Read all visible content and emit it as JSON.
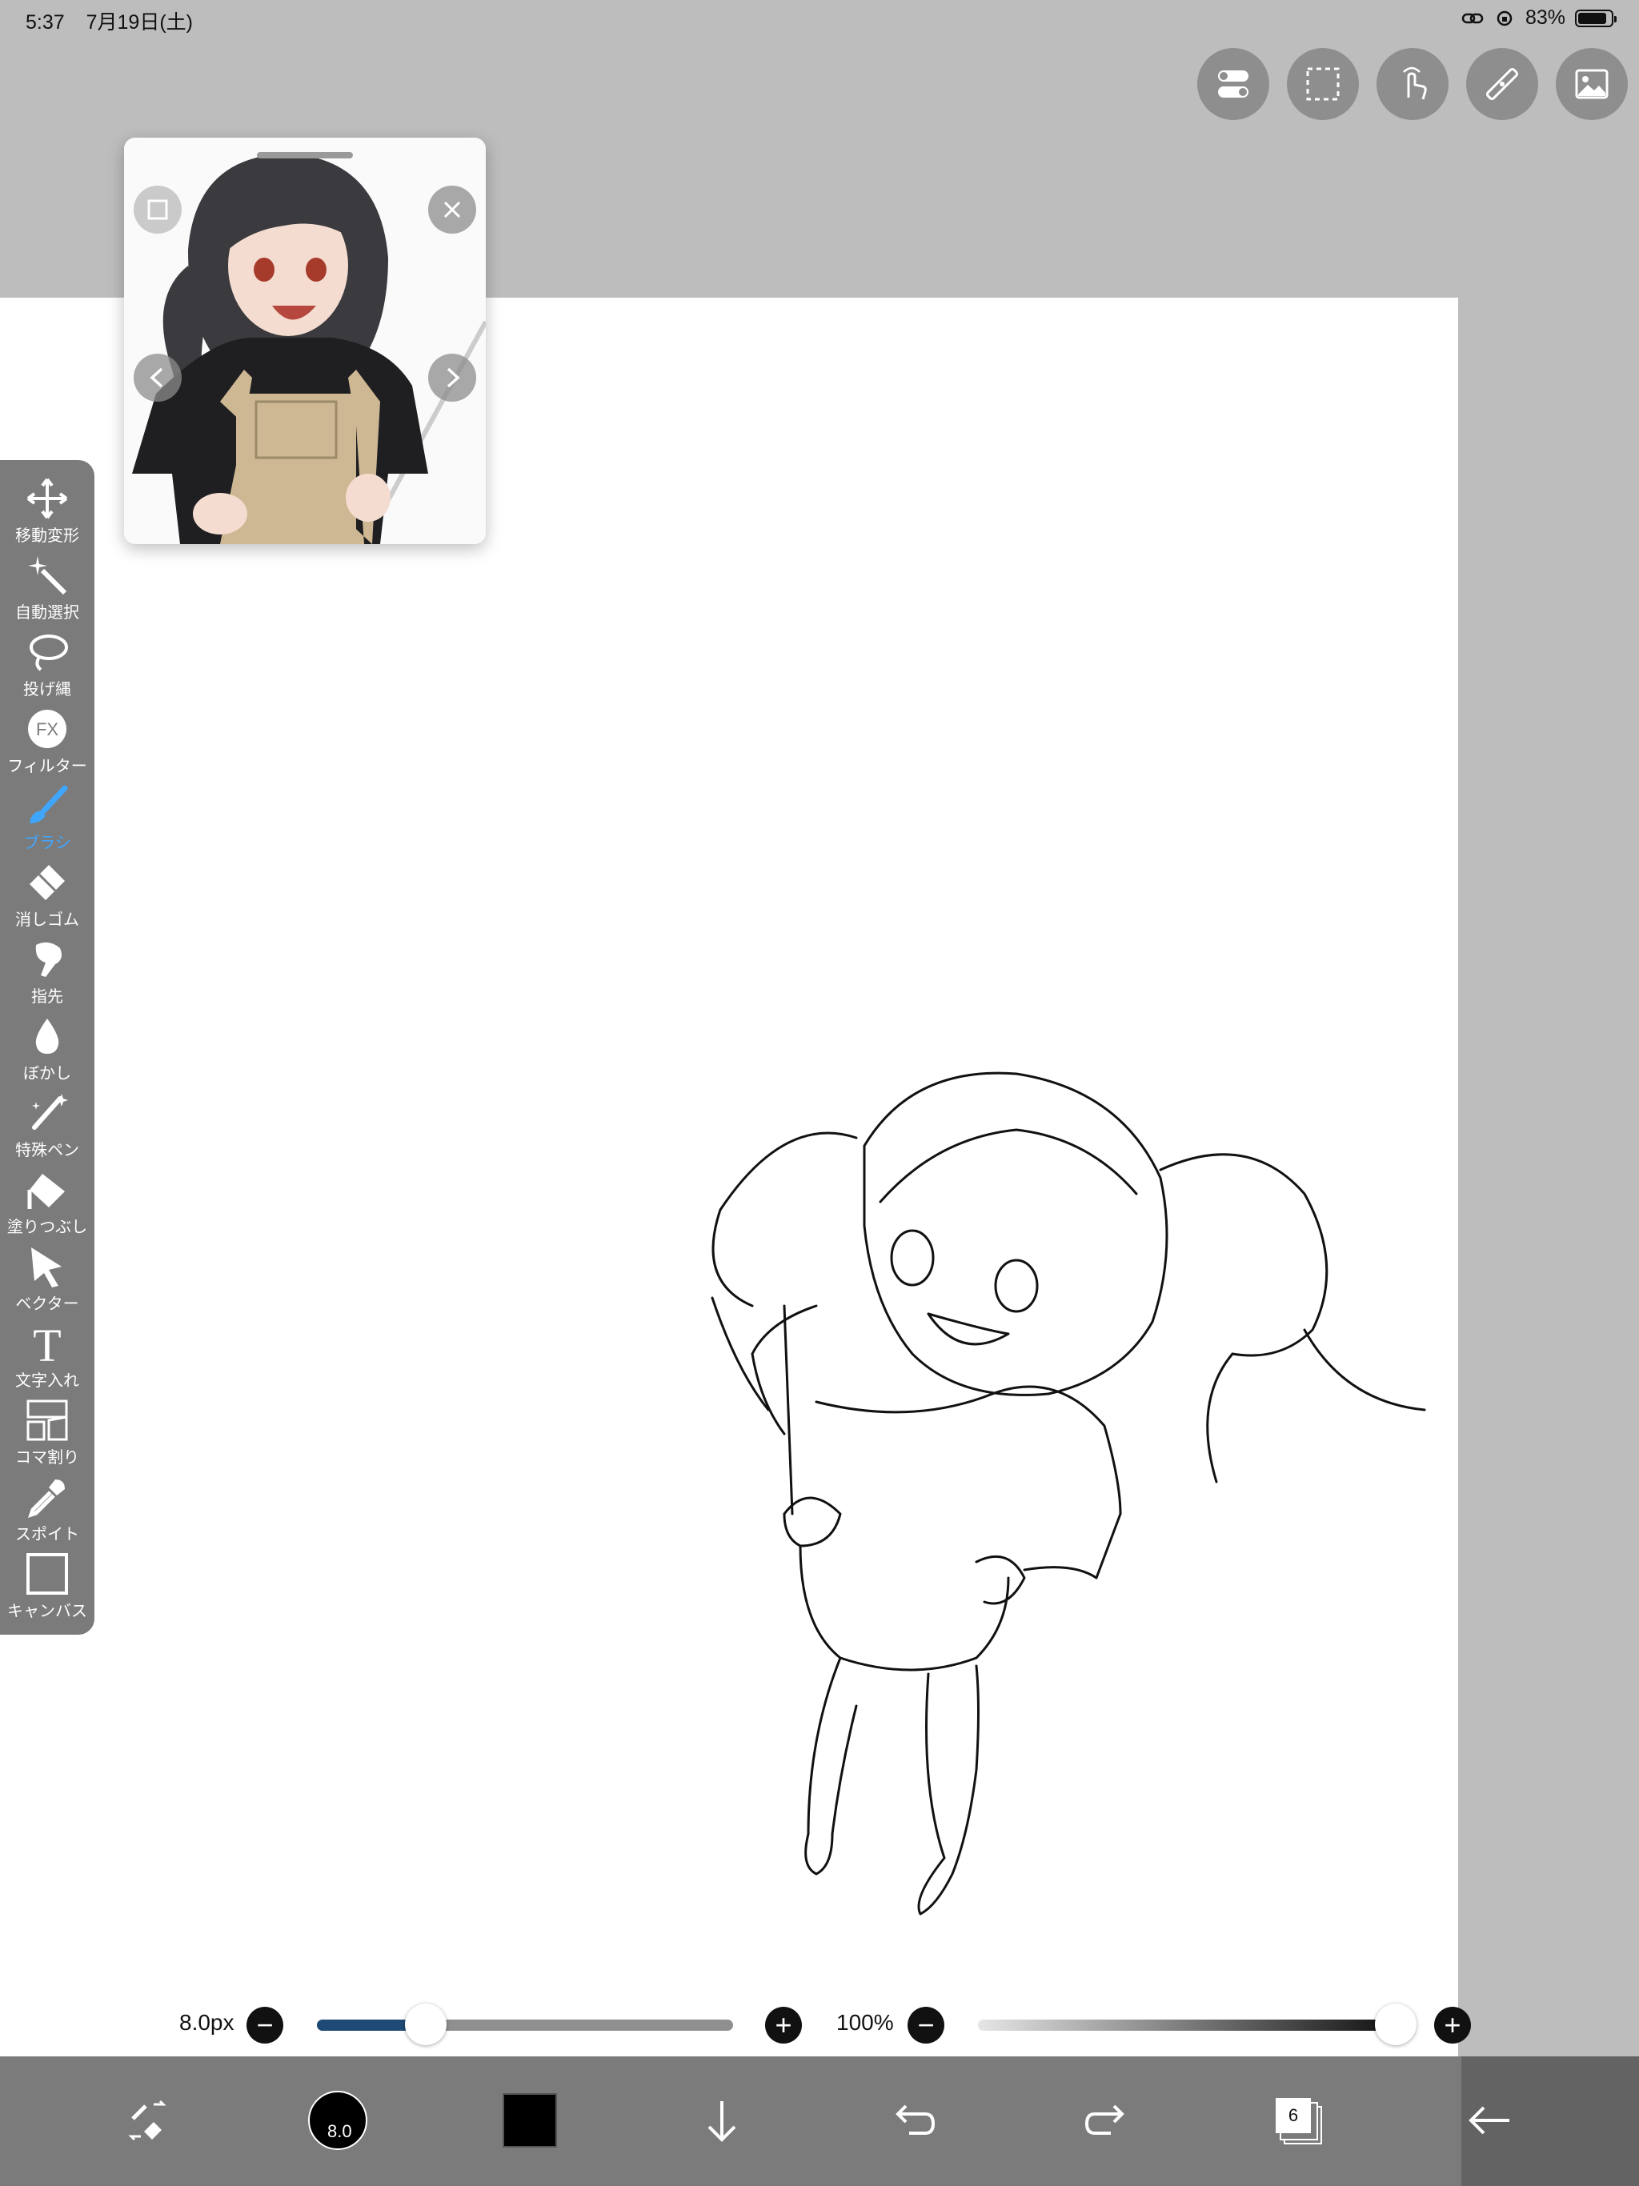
{
  "status_bar": {
    "time": "5:37",
    "date": "7月19日(土)",
    "battery_pct": "83%",
    "battery_level": 0.83
  },
  "top_tools": [
    "toggle-icon",
    "selection-icon",
    "touch-icon",
    "ruler-icon",
    "image-icon"
  ],
  "reference_window": {
    "icons": [
      "checkbox-icon",
      "close-icon",
      "chevron-left-icon",
      "chevron-right-icon"
    ]
  },
  "left_toolbar": {
    "items": [
      {
        "label": "移動変形",
        "icon": "move-icon"
      },
      {
        "label": "自動選択",
        "icon": "magic-wand-icon"
      },
      {
        "label": "投げ縄",
        "icon": "lasso-icon"
      },
      {
        "label": "フィルター",
        "icon": "fx-icon",
        "icon_text": "FX"
      },
      {
        "label": "ブラシ",
        "icon": "brush-icon",
        "active": true
      },
      {
        "label": "消しゴム",
        "icon": "eraser-icon"
      },
      {
        "label": "指先",
        "icon": "finger-icon"
      },
      {
        "label": "ぼかし",
        "icon": "blur-drop-icon"
      },
      {
        "label": "特殊ペン",
        "icon": "special-pen-icon"
      },
      {
        "label": "塗りつぶし",
        "icon": "fill-bucket-icon"
      },
      {
        "label": "ベクター",
        "icon": "vector-cursor-icon"
      },
      {
        "label": "文字入れ",
        "icon": "text-icon",
        "icon_text": "T"
      },
      {
        "label": "コマ割り",
        "icon": "panel-frame-icon"
      },
      {
        "label": "スポイト",
        "icon": "eyedropper-icon"
      },
      {
        "label": "キャンバス",
        "icon": "canvas-icon"
      }
    ]
  },
  "sliders": {
    "brush_size": {
      "label": "8.0px",
      "value_fraction": 0.26
    },
    "opacity": {
      "label": "100%",
      "value_fraction": 1.0
    }
  },
  "bottom_bar": {
    "brush_size_text": "8.0",
    "color": "#000000",
    "layers_count": "6",
    "icons": [
      "pen-eraser-switch-icon",
      "brush-size-icon",
      "color-swatch-icon",
      "arrow-down-icon",
      "undo-icon",
      "redo-icon",
      "layers-icon",
      "back-arrow-icon"
    ]
  },
  "colors": {
    "canvas_bg": "#bdbdbd",
    "toolbar_bg": "#7b7b7b",
    "active_accent": "#3fa6ff",
    "size_track": "#1f4a75"
  }
}
